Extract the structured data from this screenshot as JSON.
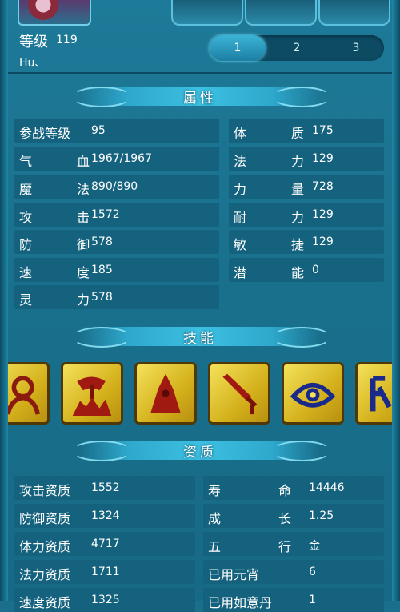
{
  "header": {
    "level_label": "等级",
    "level_value": "119",
    "name": "Hu、",
    "page_tabs": [
      "1",
      "2",
      "3"
    ],
    "active_tab": "1"
  },
  "attributes": {
    "title": "属性",
    "left": [
      {
        "label": "参战等级",
        "value": "95"
      },
      {
        "label": "气　血",
        "value": "1967/1967"
      },
      {
        "label": "魔　法",
        "value": "890/890"
      },
      {
        "label": "攻　击",
        "value": "1572"
      },
      {
        "label": "防　御",
        "value": "578"
      },
      {
        "label": "速　度",
        "value": "185"
      },
      {
        "label": "灵　力",
        "value": "578"
      }
    ],
    "right": [
      {
        "label": "体　质",
        "value": "175"
      },
      {
        "label": "法　力",
        "value": "129"
      },
      {
        "label": "力　量",
        "value": "728"
      },
      {
        "label": "耐　力",
        "value": "129"
      },
      {
        "label": "敏　捷",
        "value": "129"
      },
      {
        "label": "潜　能",
        "value": "0"
      }
    ]
  },
  "skills": {
    "title": "技能",
    "icons": [
      "person-skill-icon",
      "axe-skill-icon",
      "flame-figure-skill-icon",
      "sword-skill-icon",
      "eye-skill-icon",
      "glyph-skill-icon"
    ]
  },
  "aptitude": {
    "title": "资质",
    "left": [
      {
        "label": "攻击资质",
        "value": "1552"
      },
      {
        "label": "防御资质",
        "value": "1324"
      },
      {
        "label": "体力资质",
        "value": "4717"
      },
      {
        "label": "法力资质",
        "value": "1711"
      },
      {
        "label": "速度资质",
        "value": "1325"
      }
    ],
    "right": [
      {
        "label": "寿　命",
        "value": "14446"
      },
      {
        "label": "成　长",
        "value": "1.25"
      },
      {
        "label": "五　行",
        "value": "金"
      },
      {
        "label": "已用元宵",
        "value": "6"
      },
      {
        "label": "已用如意丹",
        "value": "1"
      }
    ]
  }
}
